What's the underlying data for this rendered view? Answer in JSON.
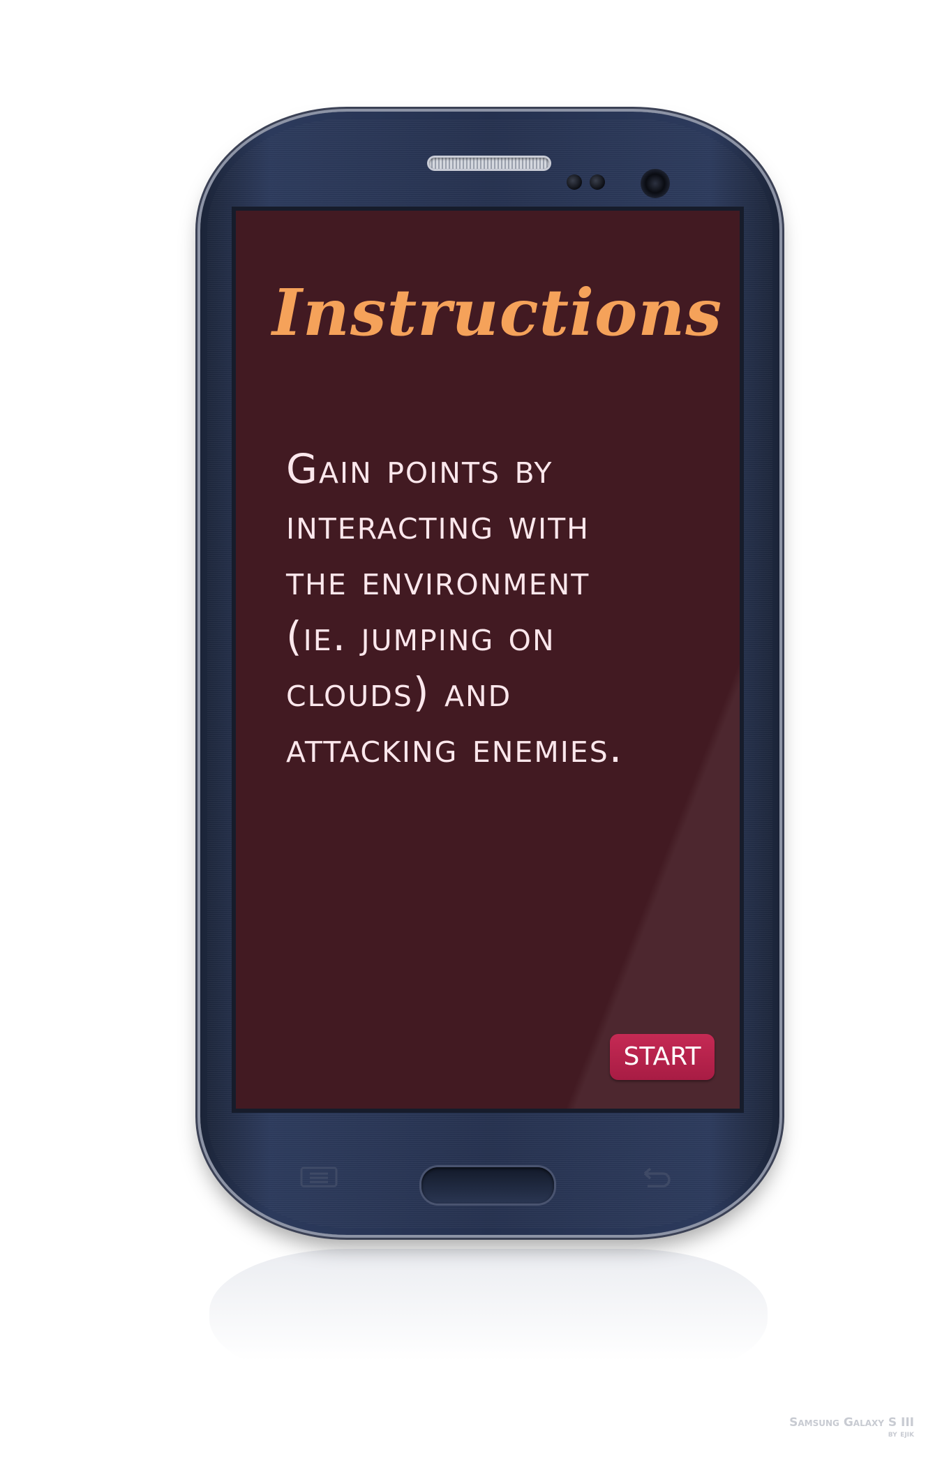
{
  "screen": {
    "title": "Instructions",
    "body_lines": [
      "Gain points by",
      "interacting with",
      "the environment",
      "(ie. jumping on",
      "clouds) and",
      "attacking enemies."
    ],
    "start_label": "START"
  },
  "device": {
    "credit_line1": "Samsung Galaxy S III",
    "credit_line2": "by ejik"
  },
  "colors": {
    "screen_background": "#421a22",
    "title": "#f5a25a",
    "body_text": "#fbe7ec",
    "start_button": "#b3214a",
    "phone_body": "#25314f"
  },
  "icons": [
    "menu-key-icon",
    "back-key-icon"
  ]
}
